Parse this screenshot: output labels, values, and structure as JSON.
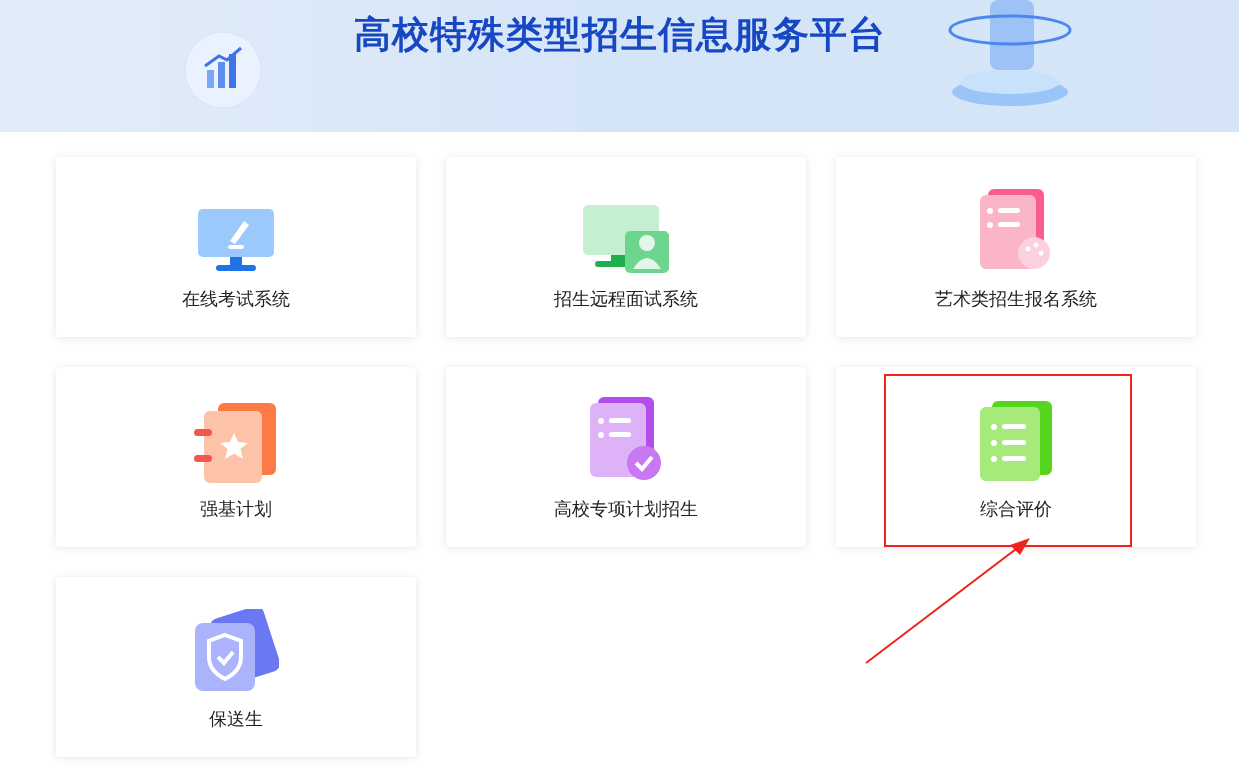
{
  "banner": {
    "title": "高校特殊类型招生信息服务平台"
  },
  "cards": [
    {
      "label": "在线考试系统",
      "kind": "monitor-pen",
      "highlighted": false
    },
    {
      "label": "招生远程面试系统",
      "kind": "monitor-person",
      "highlighted": false
    },
    {
      "label": "艺术类招生报名系统",
      "kind": "doc-palette",
      "highlighted": false
    },
    {
      "label": "强基计划",
      "kind": "doc-star",
      "highlighted": false
    },
    {
      "label": "高校专项计划招生",
      "kind": "doc-check",
      "highlighted": false
    },
    {
      "label": "综合评价",
      "kind": "doc-list",
      "highlighted": true
    },
    {
      "label": "保送生",
      "kind": "shield",
      "highlighted": false
    }
  ]
}
